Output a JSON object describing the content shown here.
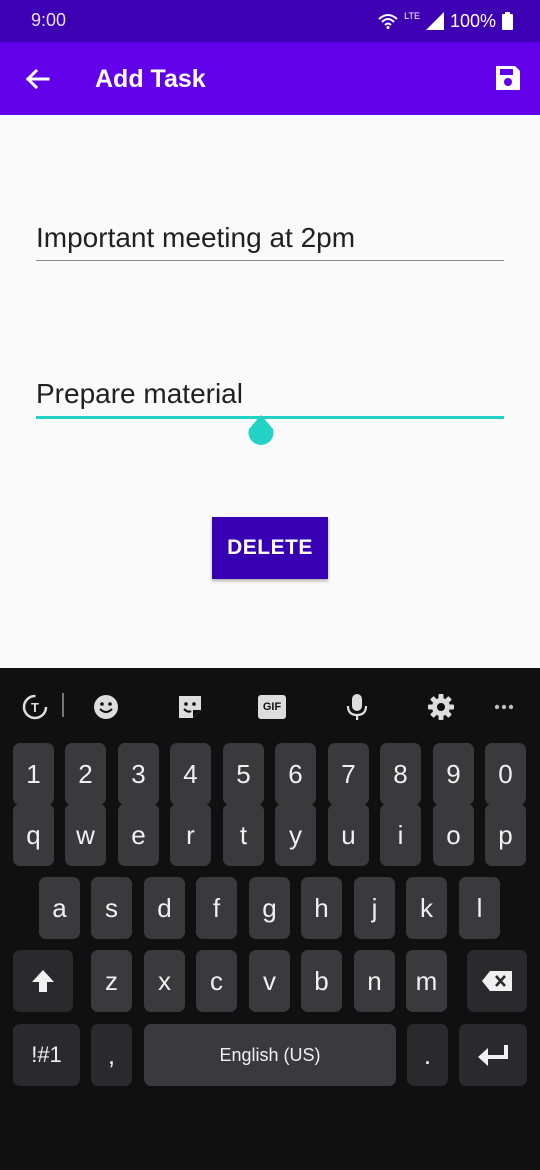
{
  "status": {
    "time": "9:00",
    "network": "LTE",
    "battery": "100%"
  },
  "appbar": {
    "title": "Add Task"
  },
  "form": {
    "title_value": "Important meeting at 2pm",
    "description_value": "Prepare material",
    "delete_label": "DELETE"
  },
  "keyboard": {
    "toolbar": [
      "translate-icon",
      "emoji-icon",
      "sticker-icon",
      "gif-icon",
      "mic-icon",
      "gear-icon",
      "more-icon"
    ],
    "gif_label": "GIF",
    "row_numbers": [
      "1",
      "2",
      "3",
      "4",
      "5",
      "6",
      "7",
      "8",
      "9",
      "0"
    ],
    "row1": [
      "q",
      "w",
      "e",
      "r",
      "t",
      "y",
      "u",
      "i",
      "o",
      "p"
    ],
    "row2": [
      "a",
      "s",
      "d",
      "f",
      "g",
      "h",
      "j",
      "k",
      "l"
    ],
    "row3": [
      "z",
      "x",
      "c",
      "v",
      "b",
      "n",
      "m"
    ],
    "symbols_label": "!#1",
    "comma_label": ",",
    "space_label": "English (US)",
    "period_label": "."
  },
  "colors": {
    "primary": "#6200ea",
    "primary_dark": "#3700b3",
    "accent": "#22d3c5"
  }
}
